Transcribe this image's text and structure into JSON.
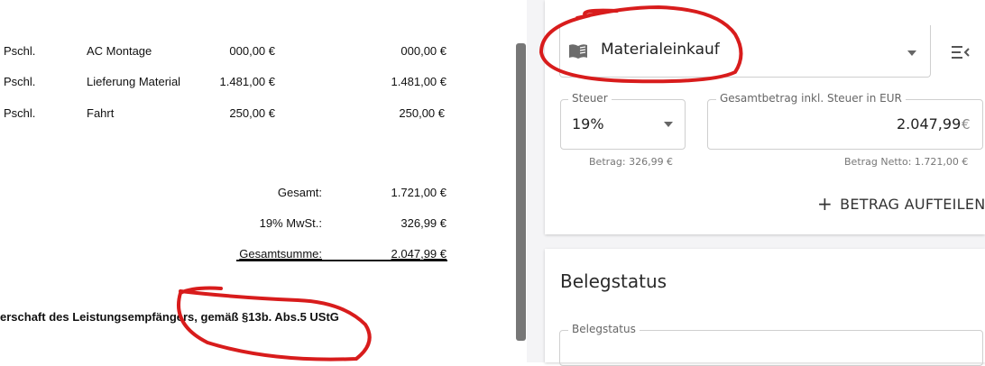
{
  "document": {
    "lines": [
      {
        "unit": "Pschl.",
        "description": "AC Montage",
        "price": "000,00 €",
        "total": "000,00 €"
      },
      {
        "unit": "Pschl.",
        "description": "Lieferung Material",
        "price": "1.481,00 €",
        "total": "1.481,00 €"
      },
      {
        "unit": "Pschl.",
        "description": "Fahrt",
        "price": "250,00 €",
        "total": "250,00 €"
      }
    ],
    "totals": {
      "gesamt_label": "Gesamt:",
      "gesamt_value": "1.721,00 €",
      "mwst_label": "19% MwSt.:",
      "mwst_value": "326,99 €",
      "summe_label": "Gesamtsumme:",
      "summe_value": "2.047,99 €"
    },
    "clause": "erschaft des Leistungsempfängers, gemäß §13b. Abs.5 UStG"
  },
  "panel": {
    "category": {
      "value": "Materialeinkauf",
      "icon": "book-icon"
    },
    "steuer": {
      "label": "Steuer",
      "value": "19%",
      "hint": "Betrag: 326,99 €"
    },
    "gesamtbetrag": {
      "label": "Gesamtbetrag inkl. Steuer in EUR",
      "value": "2.047,99",
      "currency": "€",
      "hint": "Betrag Netto: 1.721,00 €"
    },
    "split_button": "BETRAG AUFTEILEN",
    "belegstatus": {
      "title": "Belegstatus",
      "field_label": "Belegstatus"
    }
  },
  "colors": {
    "annotation": "#d81c1c",
    "divider": "#777777"
  }
}
